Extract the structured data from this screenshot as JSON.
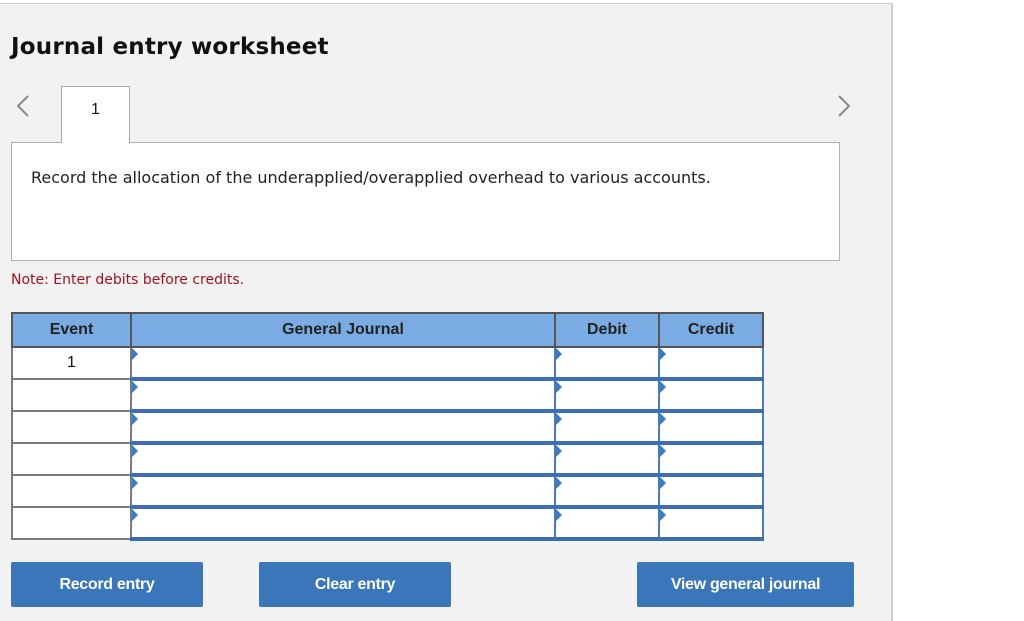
{
  "title": "Journal entry worksheet",
  "navigation": {
    "prev_icon": "chevron-left-icon",
    "next_icon": "chevron-right-icon"
  },
  "tabs": [
    {
      "label": "1",
      "active": true
    }
  ],
  "instruction": "Record the allocation of the underapplied/overapplied overhead to various accounts.",
  "note": "Note: Enter debits before credits.",
  "table": {
    "headers": {
      "event": "Event",
      "general_journal": "General Journal",
      "debit": "Debit",
      "credit": "Credit"
    },
    "rows": [
      {
        "event": "1",
        "account": "",
        "debit": "",
        "credit": ""
      },
      {
        "event": "",
        "account": "",
        "debit": "",
        "credit": ""
      },
      {
        "event": "",
        "account": "",
        "debit": "",
        "credit": ""
      },
      {
        "event": "",
        "account": "",
        "debit": "",
        "credit": ""
      },
      {
        "event": "",
        "account": "",
        "debit": "",
        "credit": ""
      },
      {
        "event": "",
        "account": "",
        "debit": "",
        "credit": ""
      }
    ]
  },
  "buttons": {
    "record": "Record entry",
    "clear": "Clear entry",
    "view": "View general journal"
  },
  "colors": {
    "accent": "#3a76b9",
    "header_bg": "#7aace3",
    "note": "#a0141e"
  }
}
